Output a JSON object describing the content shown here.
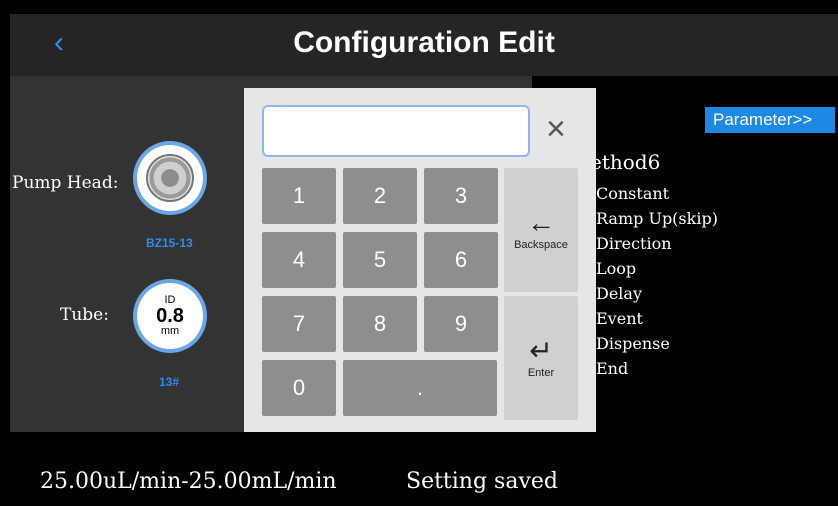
{
  "header": {
    "back_icon": "chevron-left-icon",
    "title": "Configuration Edit"
  },
  "left_panel": {
    "pump_head_label": "Pump Head:",
    "pump_model": "BZ15-13",
    "tube_label": "Tube:",
    "tube_id": "ID",
    "tube_value": "0.8",
    "tube_unit": "mm",
    "tube_number": "13#"
  },
  "right_panel": {
    "parameter_button": "Parameter>>",
    "method_title": "ethod6",
    "items": [
      "Constant",
      "Ramp Up(skip)",
      "Direction",
      "Loop",
      "Delay",
      "Event",
      "Dispense",
      "End"
    ]
  },
  "keypad": {
    "input_value": "",
    "close_icon": "close-icon",
    "keys": [
      "1",
      "2",
      "3",
      "4",
      "5",
      "6",
      "7",
      "8",
      "9",
      "0",
      "."
    ],
    "backspace_label": "Backspace",
    "enter_label": "Enter"
  },
  "footer": {
    "range": "25.00uL/min-25.00mL/min",
    "status": "Setting saved"
  },
  "colors": {
    "accent": "#2d8cf0",
    "parameter_button": "#1e88e5",
    "background": "#2b2b2b"
  }
}
